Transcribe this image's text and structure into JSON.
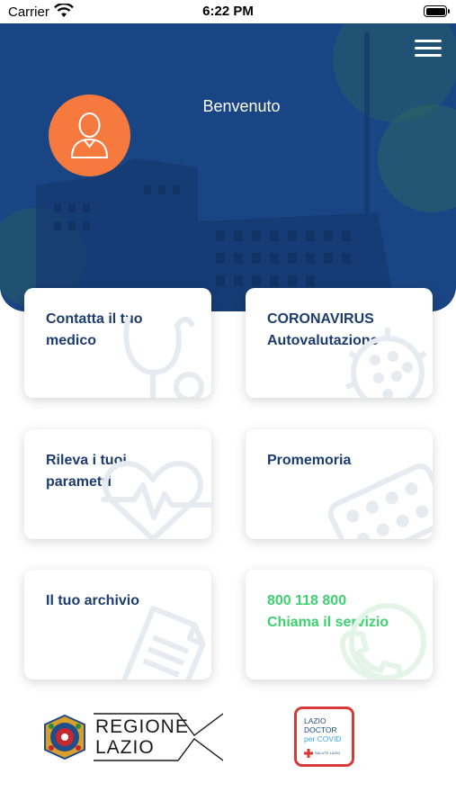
{
  "status_bar": {
    "carrier": "Carrier",
    "time": "6:22 PM"
  },
  "header": {
    "welcome": "Benvenuto"
  },
  "cards": [
    {
      "label": "Contatta il tuo\nmedico",
      "icon": "stethoscope-icon"
    },
    {
      "label": "CORONAVIRUS\nAutovalutazione",
      "icon": "virus-icon"
    },
    {
      "label": "Rileva i tuoi\nparametri",
      "icon": "heartbeat-icon"
    },
    {
      "label": "Promemoria",
      "icon": "pills-icon"
    },
    {
      "label": "Il tuo archivio",
      "icon": "document-icon"
    },
    {
      "label": "800 118 800\nChiama il servizio",
      "icon": "phone-icon"
    }
  ],
  "footer": {
    "regione_line1": "REGIONE",
    "regione_line2": "LAZIO",
    "doctor_line1": "LAZIO",
    "doctor_line2": "DOCTOR",
    "doctor_line3": "per COVID",
    "doctor_line4": "SALUTE LAZIO"
  },
  "colors": {
    "primary": "#1d4e90",
    "accent": "#f67a3d",
    "green": "#3dd26f",
    "title": "#1d3c6e"
  }
}
